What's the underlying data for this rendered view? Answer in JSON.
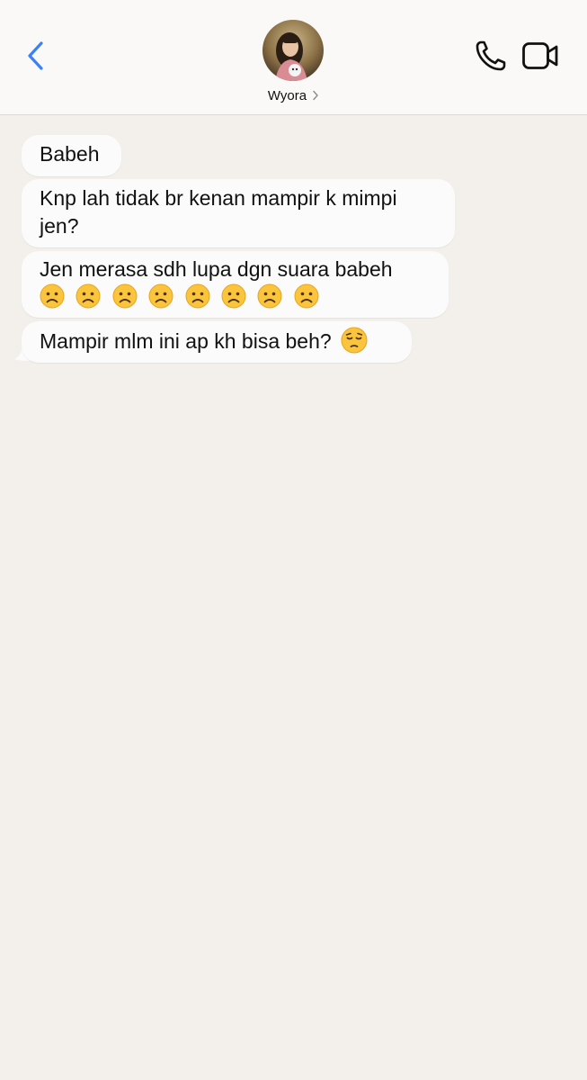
{
  "header": {
    "contact_name": "Wyora",
    "back_icon": "chevron-left-icon",
    "call_icon": "phone-icon",
    "video_icon": "video-camera-icon",
    "accent_color": "#3b82f6"
  },
  "messages": [
    {
      "text": "Babeh",
      "emojis": []
    },
    {
      "text": "Knp lah tidak br kenan mampir k mimpi jen?",
      "emojis": []
    },
    {
      "text": "Jen merasa sdh lupa dgn suara babeh",
      "emojis": [
        "frowning-face",
        "frowning-face",
        "frowning-face",
        "frowning-face",
        "frowning-face",
        "frowning-face",
        "frowning-face",
        "frowning-face"
      ]
    },
    {
      "text": "Mampir mlm ini ap kh bisa beh?",
      "emojis": [
        "pensive-face"
      ]
    }
  ]
}
